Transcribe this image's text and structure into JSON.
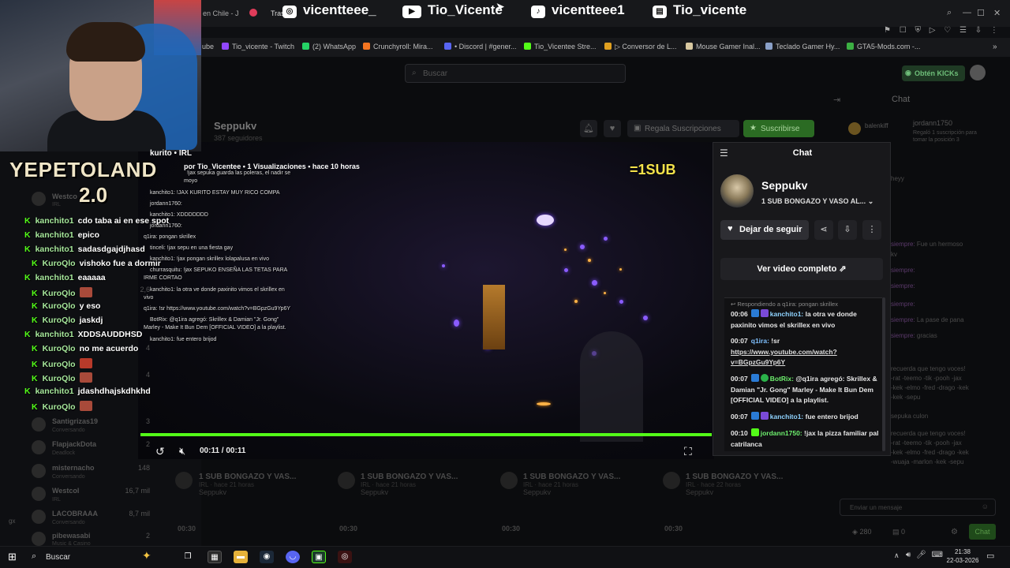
{
  "social": {
    "instagram": "vicentteee_",
    "youtube": "Tio_Vicente",
    "tiktok": "vicentteee1",
    "twitch": "Tio_vicente"
  },
  "tabs": {
    "tab1": "en Chile - J",
    "tab2": "Tras"
  },
  "bookmarks": [
    "ube",
    "Tio_vicente - Twitch",
    "(2) WhatsApp",
    "Crunchyroll: Mira...",
    "• Discord | #gener...",
    "Tio_Vicentee Stre...",
    "▷ Conversor de L...",
    "Mouse Gamer Inal...",
    "Teclado Gamer Hy...",
    "GTA5-Mods.com -..."
  ],
  "page": {
    "search_placeholder": "Buscar",
    "kicks_button": "Obtén KICKs",
    "channel_name": "Seppukv",
    "channel_followers": "387 seguidores",
    "gift_button": "Regala Suscripciones",
    "subscribe_button": "Suscribirse",
    "chat_label": "Chat"
  },
  "video": {
    "time": "00:11 / 00:11",
    "sub_badge": "=1SUB",
    "progress_pct": 100
  },
  "overlay": {
    "logo_line1": "YEPETOLAND",
    "logo_line2": "2.0",
    "kurito": "kurito • IRL",
    "vod_info": "por Tio_Vicentee • 1 Visualizaciones • hace 10 horas",
    "chat": [
      {
        "user": "kanchito1",
        "msg": "cdo taba ai en ese spot"
      },
      {
        "user": "kanchito1",
        "msg": "epico"
      },
      {
        "user": "kanchito1",
        "msg": "sadasdgajdjhasd"
      },
      {
        "user": "KuroQlo",
        "msg": "vishoko fue a dormir"
      },
      {
        "user": "kanchito1",
        "msg": "eaaaaa"
      },
      {
        "user": "KuroQlo",
        "msg": ""
      },
      {
        "user": "KuroQlo",
        "msg": "y eso"
      },
      {
        "user": "KuroQlo",
        "msg": "jaskdj"
      },
      {
        "user": "kanchito1",
        "msg": "XDDSAUDDHSD"
      },
      {
        "user": "KuroQlo",
        "msg": "no me acuerdo"
      },
      {
        "user": "KuroQlo",
        "msg": ""
      },
      {
        "user": "KuroQlo",
        "msg": ""
      },
      {
        "user": "kanchito1",
        "msg": "jdashdhajskdhkhd"
      },
      {
        "user": "KuroQlo",
        "msg": ""
      }
    ],
    "small_chat": [
      "!jax sepuka guarda las poleras, el nadir se",
      "moyo",
      "kanchito1: !JAX KURITO ESTAY MUY RICO COMPA",
      "jordann1760:",
      "kanchito1: XDDDDDDD",
      "jordann1760:",
      "q1ira: pongan skrillex",
      "tinceli: !jax sepu en una fiesta gay",
      "kanchito1: !jax pongan skrillex lolapalusa en vivo",
      "churrasquitu: !jax SEPUKO ENSEÑA LAS TETAS PARA",
      "IRME CORTAO",
      "kanchito1: la otra ve donde paxinito vimos el skrillex en",
      "vivo",
      "q1ira: !sr https://www.youtube.com/watch?v=BGpzGu9Yp6Y",
      "BotRix: @q1ira agregó: Skrillex & Damian \"Jr. Gong\"",
      "Marley - Make It Bun Dem [OFFICIAL VIDEO] a la playlist.",
      "kanchito1: fue entero brijod"
    ]
  },
  "sidebar": [
    {
      "name": "Westco",
      "sub": "IRL",
      "count": ""
    },
    {
      "name": "Santigrizas19",
      "sub": "Conversando",
      "count": "3"
    },
    {
      "name": "FlapjackDota",
      "sub": "Deadlock",
      "count": "2"
    },
    {
      "name": "misternacho",
      "sub": "Conversando",
      "count": "148"
    },
    {
      "name": "Westcol",
      "sub": "IRL",
      "count": "16,7 mil"
    },
    {
      "name": "LACOBRAAA",
      "sub": "Conversando",
      "count": "8,7 mil"
    },
    {
      "name": "pibewasabi",
      "sub": "Music & Casino",
      "count": "2"
    }
  ],
  "sidebar_extra": {
    "gx": "gx",
    "counts": [
      "2,6",
      "4",
      "4"
    ]
  },
  "popout": {
    "title": "Chat",
    "channel": "Seppukv",
    "subtitle": "1 SUB BONGAZO Y VASO AL...",
    "unfollow": "Dejar de seguir",
    "full_video": "Ver video completo",
    "reply": "Respondiendo a q1ira: pongan skrillex",
    "messages": [
      {
        "time": "00:06",
        "user": "kanchito1:",
        "text": "la otra ve donde paxinito vimos el skrillex en vivo"
      },
      {
        "time": "00:07",
        "user": "q1ira:",
        "text": "!sr",
        "link": "https://www.youtube.com/watch?v=BGpzGu9Yp6Y"
      },
      {
        "time": "00:07",
        "user": "BotRix:",
        "text": "@q1ira agregó: Skrillex & Damian \"Jr. Gong\" Marley - Make It Bun Dem [OFFICIAL VIDEO] a la playlist."
      },
      {
        "time": "00:07",
        "user": "kanchito1:",
        "text": "fue entero brijod"
      },
      {
        "time": "00:10",
        "user": "jordann1750:",
        "text": "!jax la pizza familiar pal catrilanca"
      }
    ]
  },
  "right_chat": {
    "top_user": "jordann1750",
    "top_note": "Regaló 1 suscripción para tomar la posición 3",
    "lines": [
      {
        "user": "",
        "text": "heyy"
      },
      {
        "user": "siempre:",
        "text": "Fue un hermoso"
      },
      {
        "user": "",
        "text": "kv"
      },
      {
        "user": "siempre:",
        "text": ""
      },
      {
        "user": "siempre:",
        "text": ""
      },
      {
        "user": "siempre:",
        "text": ""
      },
      {
        "user": "siempre:",
        "text": "La pase de pana"
      },
      {
        "user": "siempre:",
        "text": "gracias"
      },
      {
        "user": "",
        "text": "recuerda que tengo voces!"
      },
      {
        "user": "",
        "text": "-rat -teemo -tik -pooh -jax"
      },
      {
        "user": "",
        "text": "-kek -elmo -fred -drago -kek"
      },
      {
        "user": "",
        "text": "-kek -sepu"
      },
      {
        "user": "",
        "text": "sepuka culon"
      },
      {
        "user": "",
        "text": "recuerda que tengo voces!"
      },
      {
        "user": "",
        "text": "-rat -teemo -tik -pooh -jax"
      },
      {
        "user": "",
        "text": "-kek -elmo -fred -drago -kek"
      },
      {
        "user": "",
        "text": "-wuaja -marlon -kek -sepu"
      }
    ],
    "balance_user": "balenkiff",
    "input_placeholder": "Enviar un mensaje",
    "points": "280",
    "zero": "0",
    "send": "Chat"
  },
  "thumbnails": [
    {
      "title": "1 SUB BONGAZO Y VAS...",
      "meta": "IRL · hace 21 horas",
      "channel": "Seppukv",
      "duration": "00:30"
    },
    {
      "title": "1 SUB BONGAZO Y VAS...",
      "meta": "IRL · hace 21 horas",
      "channel": "Seppukv",
      "duration": "00:30"
    },
    {
      "title": "1 SUB BONGAZO Y VAS...",
      "meta": "IRL · hace 21 horas",
      "channel": "Seppukv",
      "duration": "00:30"
    },
    {
      "title": "1 SUB BONGAZO Y VAS...",
      "meta": "IRL · hace 22 horas",
      "channel": "Seppukv",
      "duration": "00:30"
    }
  ],
  "taskbar": {
    "search": "Buscar",
    "time": "21:38",
    "date": "22-03-2026"
  }
}
